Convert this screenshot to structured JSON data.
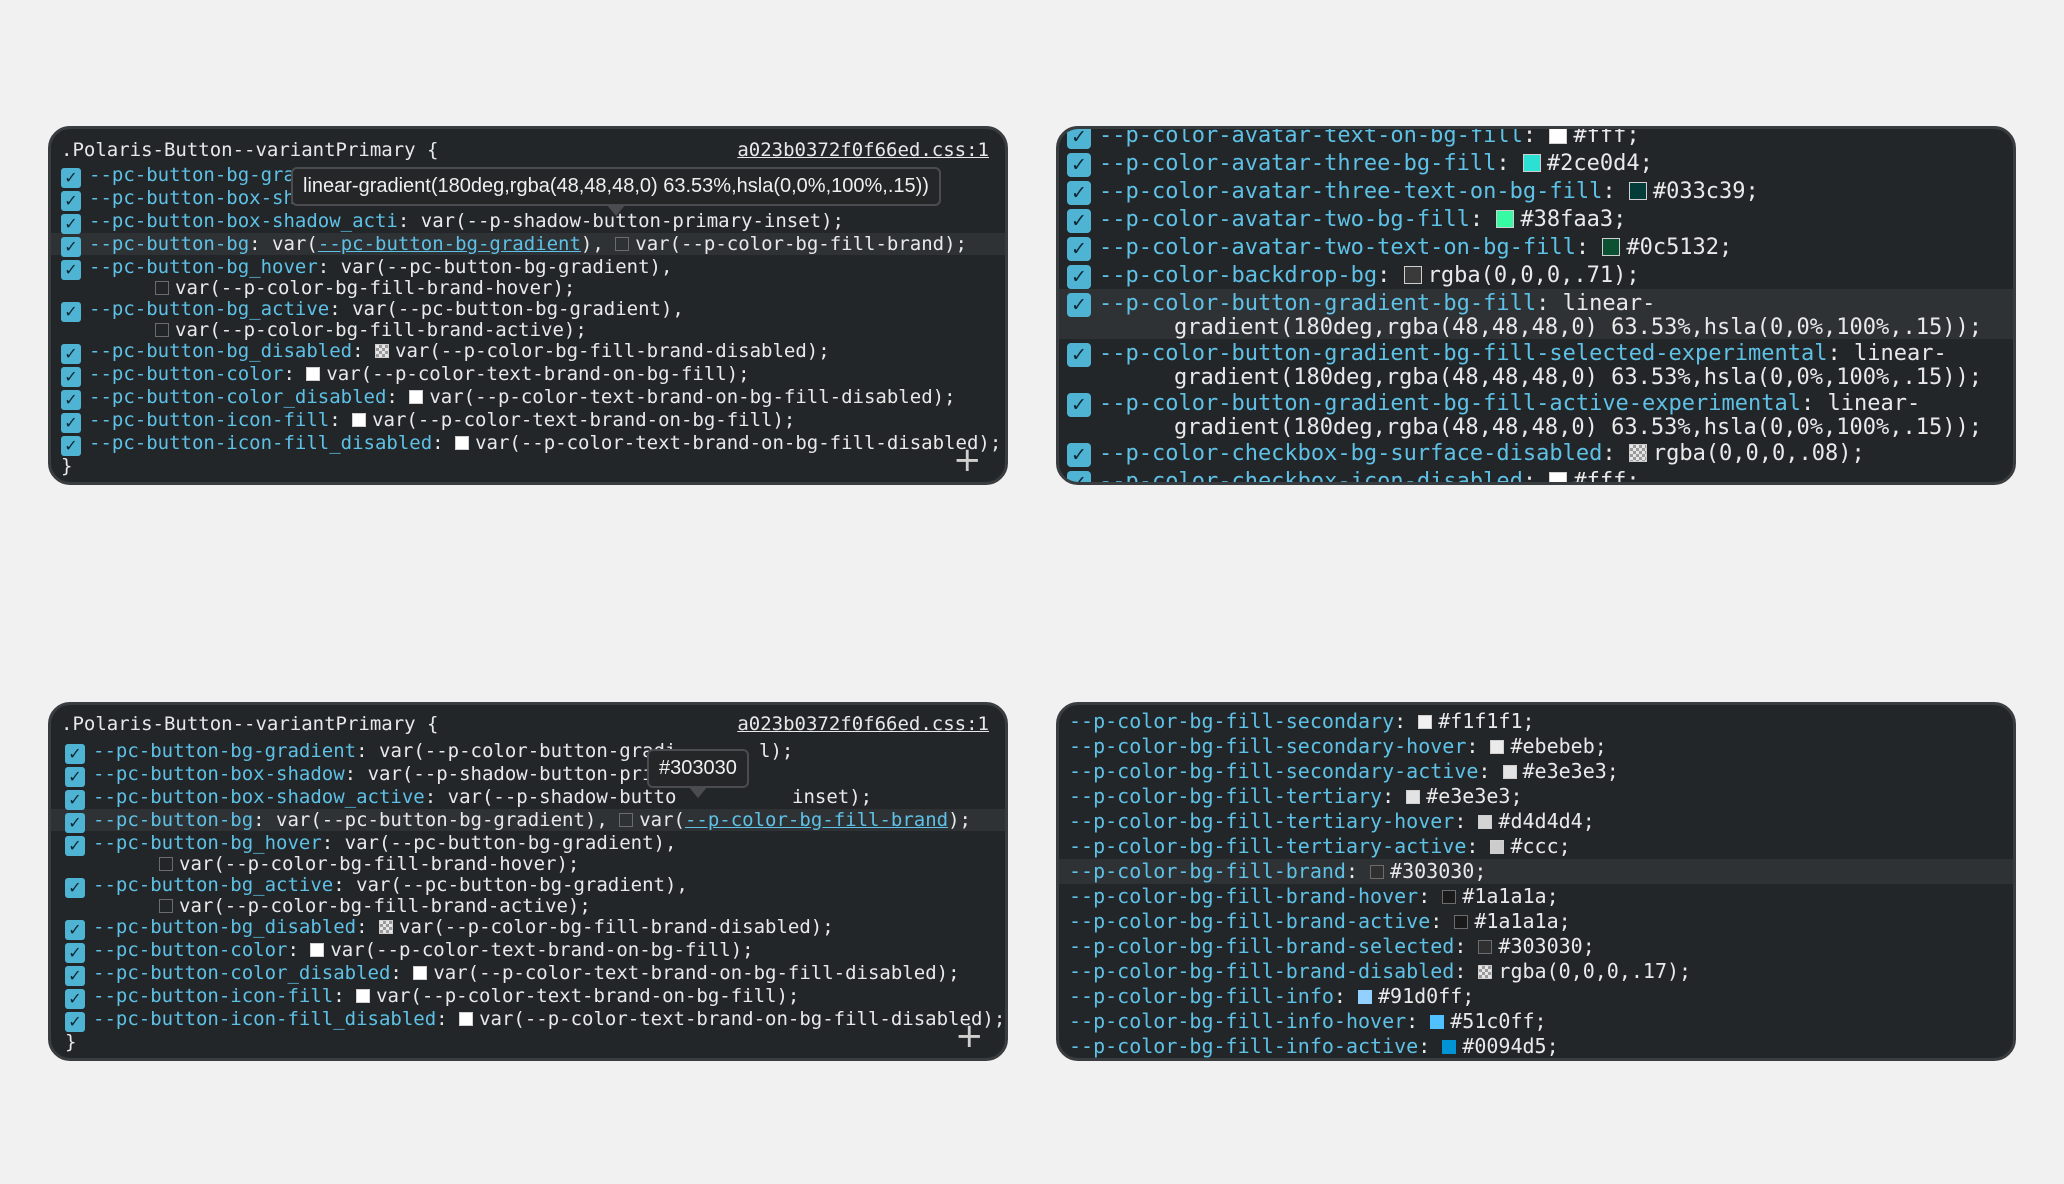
{
  "colors": {
    "background": "#f1f1f2",
    "panel": "#232629",
    "property": "#5ec1e6",
    "value": "#e9e9e9",
    "checkbox": "#4fb3d4"
  },
  "panel_tl": {
    "selector": ".Polaris-Button--variantPrimary {",
    "source": "a023b0372f0f66ed.css:1",
    "close": "}",
    "plus": "+",
    "tooltip": "linear-gradient(180deg,rgba(48,48,48,0) 63.53%,hsla(0,0%,100%,.15))",
    "lines": [
      {
        "prop": "--pc-button-bg-grad",
        "sep": "",
        "val": ""
      },
      {
        "prop": "--pc-button-box-sha",
        "sep": "",
        "val": ""
      },
      {
        "prop": "--pc-button-box-shadow_acti",
        "sep": ": ",
        "val": "var(--p-shadow-button-primary-inset);"
      },
      {
        "prop": "--pc-button-bg",
        "sep": ": ",
        "v1": "var(",
        "link": "--pc-button-bg-gradient",
        "v2": "), ",
        "v3": "var(--p-color-bg-fill-brand);"
      },
      {
        "prop": "--pc-button-bg_hover",
        "sep": ": ",
        "val": "var(--pc-button-bg-gradient),"
      },
      {
        "val": "var(--p-color-bg-fill-brand-hover);"
      },
      {
        "prop": "--pc-button-bg_active",
        "sep": ": ",
        "val": "var(--pc-button-bg-gradient),"
      },
      {
        "val": "var(--p-color-bg-fill-brand-active);"
      },
      {
        "prop": "--pc-button-bg_disabled",
        "sep": ": ",
        "val": "var(--p-color-bg-fill-brand-disabled);"
      },
      {
        "prop": "--pc-button-color",
        "sep": ": ",
        "val": "var(--p-color-text-brand-on-bg-fill);"
      },
      {
        "prop": "--pc-button-color_disabled",
        "sep": ": ",
        "val": "var(--p-color-text-brand-on-bg-fill-disabled);"
      },
      {
        "prop": "--pc-button-icon-fill",
        "sep": ": ",
        "val": "var(--p-color-text-brand-on-bg-fill);"
      },
      {
        "prop": "--pc-button-icon-fill_disabled",
        "sep": ": ",
        "val": "var(--p-color-text-brand-on-bg-fill-disabled);"
      }
    ]
  },
  "panel_bl": {
    "selector": ".Polaris-Button--variantPrimary {",
    "source": "a023b0372f0f66ed.css:1",
    "close": "}",
    "plus": "+",
    "tooltip": "#303030",
    "lines": [
      {
        "prop": "--pc-button-bg-gradient",
        "sep": ": ",
        "val": "var(--p-color-button-gradi"
      },
      {
        "prop": "--pc-button-box-shadow",
        "sep": ": ",
        "val": "var(--p-shadow-button-prima"
      },
      {
        "prop": "--pc-button-box-shadow_active",
        "sep": ": ",
        "val": "var(--p-shadow-butto"
      },
      {
        "prop": "--pc-button-bg",
        "sep": ": ",
        "v1": "var(--pc-button-bg-gradient), ",
        "v2": "var(",
        "link": "--p-color-bg-fill-brand",
        "v3": ");"
      },
      {
        "prop": "--pc-button-bg_hover",
        "sep": ": ",
        "val": "var(--pc-button-bg-gradient),"
      },
      {
        "val": "var(--p-color-bg-fill-brand-hover);"
      },
      {
        "prop": "--pc-button-bg_active",
        "sep": ": ",
        "val": "var(--pc-button-bg-gradient),"
      },
      {
        "val": "var(--p-color-bg-fill-brand-active);"
      },
      {
        "prop": "--pc-button-bg_disabled",
        "sep": ": ",
        "val": "var(--p-color-bg-fill-brand-disabled);"
      },
      {
        "prop": "--pc-button-color",
        "sep": ": ",
        "val": "var(--p-color-text-brand-on-bg-fill);"
      },
      {
        "prop": "--pc-button-color_disabled",
        "sep": ": ",
        "val": "var(--p-color-text-brand-on-bg-fill-disabled);"
      },
      {
        "prop": "--pc-button-icon-fill",
        "sep": ": ",
        "val": "var(--p-color-text-brand-on-bg-fill);"
      },
      {
        "prop": "--pc-button-icon-fill_disabled",
        "sep": ": ",
        "val": "var(--p-color-text-brand-on-bg-fill-disabled);"
      }
    ],
    "tail_1": "l);",
    "tail_3": "inset);"
  },
  "panel_tr": {
    "lines": [
      {
        "prop": "--p-color-avatar-text-on-bg-fill",
        "sep": ": ",
        "val": "#fff;"
      },
      {
        "prop": "--p-color-avatar-three-bg-fill",
        "sep": ": ",
        "val": "#2ce0d4;"
      },
      {
        "prop": "--p-color-avatar-three-text-on-bg-fill",
        "sep": ": ",
        "val": "#033c39;"
      },
      {
        "prop": "--p-color-avatar-two-bg-fill",
        "sep": ": ",
        "val": "#38faa3;"
      },
      {
        "prop": "--p-color-avatar-two-text-on-bg-fill",
        "sep": ": ",
        "val": "#0c5132;"
      },
      {
        "prop": "--p-color-backdrop-bg",
        "sep": ": ",
        "val": "rgba(0,0,0,.71);"
      },
      {
        "prop": "--p-color-button-gradient-bg-fill",
        "sep": ": ",
        "val": "linear-"
      },
      {
        "val": "gradient(180deg,rgba(48,48,48,0) 63.53%,hsla(0,0%,100%,.15));"
      },
      {
        "prop": "--p-color-button-gradient-bg-fill-selected-experimental",
        "sep": ": ",
        "val": "linear-"
      },
      {
        "val": "gradient(180deg,rgba(48,48,48,0) 63.53%,hsla(0,0%,100%,.15));"
      },
      {
        "prop": "--p-color-button-gradient-bg-fill-active-experimental",
        "sep": ": ",
        "val": "linear-"
      },
      {
        "val": "gradient(180deg,rgba(48,48,48,0) 63.53%,hsla(0,0%,100%,.15));"
      },
      {
        "prop": "--p-color-checkbox-bg-surface-disabled",
        "sep": ": ",
        "val": "rgba(0,0,0,.08);"
      },
      {
        "prop": "--p-color-checkbox-icon-disabled",
        "sep": ": ",
        "val": "#fff;"
      }
    ],
    "swatches": [
      "#ffffff",
      "#2ce0d4",
      "#033c39",
      "#38faa3",
      "#0c5132",
      "#3a3a3a"
    ]
  },
  "panel_br": {
    "lines": [
      {
        "prop": "--p-color-bg-fill-secondary",
        "sep": ": ",
        "val": "#f1f1f1;"
      },
      {
        "prop": "--p-color-bg-fill-secondary-hover",
        "sep": ": ",
        "val": "#ebebeb;"
      },
      {
        "prop": "--p-color-bg-fill-secondary-active",
        "sep": ": ",
        "val": "#e3e3e3;"
      },
      {
        "prop": "--p-color-bg-fill-tertiary",
        "sep": ": ",
        "val": "#e3e3e3;"
      },
      {
        "prop": "--p-color-bg-fill-tertiary-hover",
        "sep": ": ",
        "val": "#d4d4d4;"
      },
      {
        "prop": "--p-color-bg-fill-tertiary-active",
        "sep": ": ",
        "val": "#ccc;"
      },
      {
        "prop": "--p-color-bg-fill-brand",
        "sep": ": ",
        "val": "#303030;"
      },
      {
        "prop": "--p-color-bg-fill-brand-hover",
        "sep": ": ",
        "val": "#1a1a1a;"
      },
      {
        "prop": "--p-color-bg-fill-brand-active",
        "sep": ": ",
        "val": "#1a1a1a;"
      },
      {
        "prop": "--p-color-bg-fill-brand-selected",
        "sep": ": ",
        "val": "#303030;"
      },
      {
        "prop": "--p-color-bg-fill-brand-disabled",
        "sep": ": ",
        "val": "rgba(0,0,0,.17);"
      },
      {
        "prop": "--p-color-bg-fill-info",
        "sep": ": ",
        "val": "#91d0ff;"
      },
      {
        "prop": "--p-color-bg-fill-info-hover",
        "sep": ": ",
        "val": "#51c0ff;"
      },
      {
        "prop": "--p-color-bg-fill-info-active",
        "sep": ": ",
        "val": "#0094d5;"
      }
    ],
    "swatches": [
      "#f1f1f1",
      "#ebebeb",
      "#e3e3e3",
      "#e3e3e3",
      "#d4d4d4",
      "#cccccc",
      "#303030",
      "#1a1a1a",
      "#1a1a1a",
      "#303030",
      "#91d0ff",
      "#51c0ff",
      "#0094d5"
    ]
  }
}
